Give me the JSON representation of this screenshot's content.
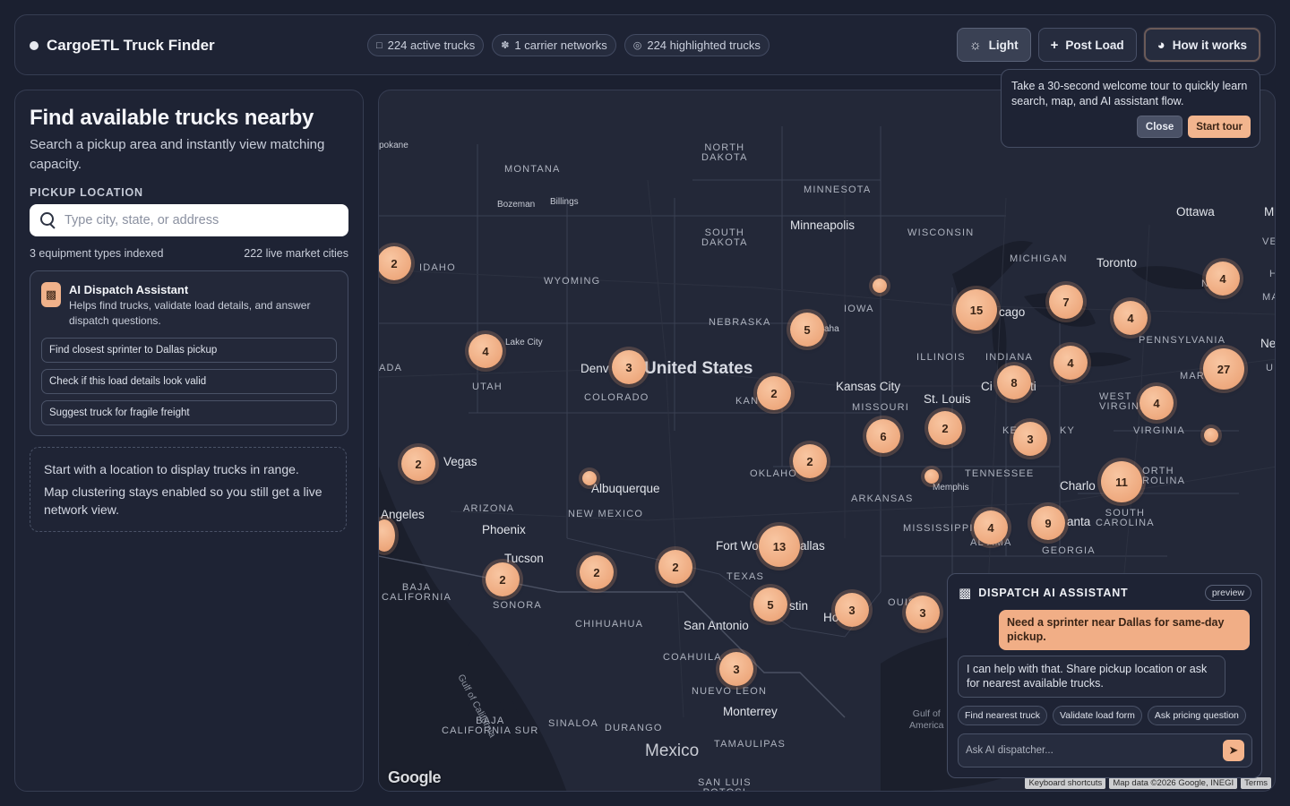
{
  "header": {
    "app_title": "CargoETL Truck Finder",
    "stats": [
      {
        "icon": "truck-icon",
        "label": "224 active trucks"
      },
      {
        "icon": "network-icon",
        "label": "1 carrier networks"
      },
      {
        "icon": "target-icon",
        "label": "224 highlighted trucks"
      }
    ],
    "buttons": {
      "light": "Light",
      "post_load": "Post Load",
      "how_it_works": "How it works"
    }
  },
  "tour": {
    "text": "Take a 30-second welcome tour to quickly learn search, map, and AI assistant flow.",
    "close": "Close",
    "start": "Start tour"
  },
  "sidebar": {
    "title": "Find available trucks nearby",
    "subtitle": "Search a pickup area and instantly view matching capacity.",
    "pickup_label": "PICKUP LOCATION",
    "search_placeholder": "Type city, state, or address",
    "equipment_types": "3 equipment types indexed",
    "market_cities": "222 live market cities",
    "assistant": {
      "title": "AI Dispatch Assistant",
      "description": "Helps find trucks, validate load details, and answer dispatch questions.",
      "suggestions": [
        "Find closest sprinter to Dallas pickup",
        "Check if this load details look valid",
        "Suggest truck for fragile freight"
      ]
    },
    "empty_state": {
      "line1": "Start with a location to display trucks in range.",
      "line2": "Map clustering stays enabled so you still get a live network view."
    }
  },
  "map": {
    "labels": {
      "north_dakota": "NORTH\nDAKOTA",
      "montana": "MONTANA",
      "minnesota": "MINNESOTA",
      "south_dakota": "SOUTH\nDAKOTA",
      "wisconsin": "WISCONSIN",
      "michigan": "MICHIGAN",
      "idaho": "IDAHO",
      "wyoming": "WYOMING",
      "iowa": "IOWA",
      "nebraska": "NEBRASKA",
      "illinois": "ILLINOIS",
      "indiana": "INDIANA",
      "pennsylvania": "PENNSYLVANIA",
      "utah": "UTAH",
      "colorado": "COLORADO",
      "missouri": "MISSOURI",
      "west_virginia": "WEST\nVIRGINIA",
      "virginia": "VIRGINIA",
      "oklahoma": "OKLAHO",
      "tennessee": "TENNESSEE",
      "north_carolina": "ORTH\nROLINA",
      "arkansas": "ARKANSAS",
      "arizona": "ARIZONA",
      "new_mexico": "NEW MEXICO",
      "mississippi": "MISSISSIPPI",
      "south_carolina": "SOUTH\nCAROLINA",
      "alabama": "AL AMA",
      "georgia": "GEORGIA",
      "texas": "TEXAS",
      "baja_california": "BAJA\nCALIFORNIA",
      "sonora": "SONORA",
      "chihuahua": "CHIHUAHUA",
      "coahuila": "COAHUILA",
      "nuevo_leon": "NUEVO LEON",
      "baja_california_sur": "BAJA\nCALIFORNIA SUR",
      "sinaloa": "SINALOA",
      "durango": "DURANGO",
      "tamaulipas": "TAMAULIPAS",
      "san_luis": "SAN LUIS\nPOTOSI",
      "united_states": "United States",
      "mexico": "Mexico",
      "spokane": "pokane",
      "bozeman": "Bozeman",
      "billings": "Billings",
      "minneapolis": "Minneapolis",
      "ottawa": "Ottawa",
      "toronto": "Toronto",
      "chicago": "cago",
      "omaha": "aha",
      "salt_lake": "Lake City",
      "denver": "Denv",
      "kansas_city": "Kansas City",
      "st_louis": "St. Louis",
      "kan": "KAN",
      "cincinnati": "Ci",
      "cincinnati2": "ti",
      "ada": "ADA",
      "las_vegas": "Vegas",
      "albuquerque": "Albuquerque",
      "los_angeles": "Angeles",
      "phoenix": "Phoenix",
      "tucson": "Tucson",
      "memphis": "Memphis",
      "charlotte": "Charlo",
      "atlanta": "anta",
      "fort_worth": "Fort Wo",
      "dallas": "allas",
      "austin": "stin",
      "houston": "Ho",
      "san_antonio": "San Antonio",
      "monterrey": "Monterrey",
      "louisiana": "OUISIA",
      "kentucky": "KE",
      "kentucky2": "KY",
      "maryland": "MARYL",
      "new_york_frag": "NEW",
      "ma": "MA",
      "ver": "VER",
      "m": "M",
      "ne": "Ne",
      "h": "H",
      "u": "U",
      "gulf_california": "Gulf of California",
      "gulf_america": "Gulf of\nAmerica"
    },
    "clusters": [
      {
        "count": 2
      },
      {
        "count": 4
      },
      {
        "count": 3
      },
      {
        "count": 5
      },
      {
        "count": 15
      },
      {
        "count": 7
      },
      {
        "count": 4
      },
      {
        "count": 4
      },
      {
        "count": 27
      },
      {
        "count": 2
      },
      {
        "count": 8
      },
      {
        "count": 4
      },
      {
        "count": 2
      },
      {
        "count": 4
      },
      {
        "count": 6
      },
      {
        "count": 3
      },
      {
        "count": 2
      },
      {
        "count": 2
      },
      {
        "count": 11
      },
      {
        "count": 4
      },
      {
        "count": 9
      },
      {
        "count": 13
      },
      {
        "count": 2
      },
      {
        "count": 2
      },
      {
        "count": 2
      },
      {
        "count": 5
      },
      {
        "count": 3
      },
      {
        "count": 3
      },
      {
        "count": 3
      }
    ],
    "google": "Google",
    "attribution": {
      "shortcuts": "Keyboard shortcuts",
      "data": "Map data ©2026 Google, INEGI",
      "terms": "Terms"
    }
  },
  "chat": {
    "title": "DISPATCH AI ASSISTANT",
    "badge": "preview",
    "user_message": "Need a sprinter near Dallas for same-day pickup.",
    "assistant_message": "I can help with that. Share pickup location or ask for nearest available trucks.",
    "quick_actions": [
      "Find nearest truck",
      "Validate load form",
      "Ask pricing question"
    ],
    "input_placeholder": "Ask AI dispatcher..."
  },
  "colors": {
    "accent": "#f0ae86",
    "background": "#1b2030",
    "panel": "#1e2334"
  }
}
